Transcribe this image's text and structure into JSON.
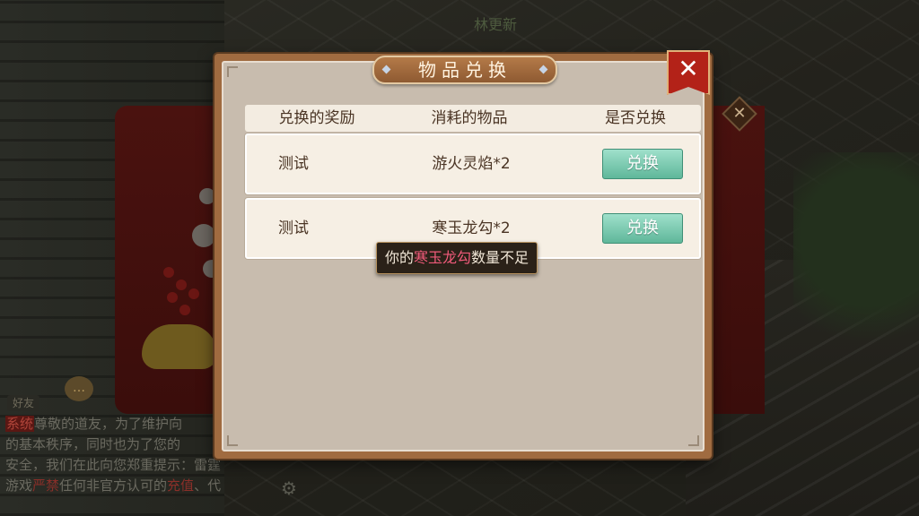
{
  "world": {
    "player_name": "林更新",
    "chat_tab": "好友",
    "chat_emoji": "…",
    "settings_glyph": "⚙",
    "close_glyph": "✕",
    "chat_lines": [
      {
        "tag": "系统",
        "text": "尊敬的道友，为了维护向"
      },
      {
        "text": "的基本秩序，同时也为了您的"
      },
      {
        "text": "安全，我们在此向您郑重提示：雷霆"
      },
      {
        "pre": "游戏",
        "hl1": "严禁",
        "mid": "任何非官方认可的",
        "hl2": "充值",
        "post": "、代"
      }
    ]
  },
  "dialog": {
    "title": "物品兑换",
    "close_glyph": "✕",
    "headers": {
      "reward": "兑换的奖励",
      "cost": "消耗的物品",
      "action": "是否兑换"
    },
    "rows": [
      {
        "reward": "测试",
        "cost": "游火灵焰*2",
        "button": "兑换"
      },
      {
        "reward": "测试",
        "cost": "寒玉龙勾*2",
        "button": "兑换"
      }
    ]
  },
  "toast": {
    "prefix": "你的",
    "item": "寒玉龙勾",
    "suffix": "数量不足"
  },
  "colors": {
    "exchange_button": "#6fc7a8",
    "title_plate": "#a46a3c",
    "close_button": "#b32218",
    "toast_item": "#f05a7a"
  }
}
